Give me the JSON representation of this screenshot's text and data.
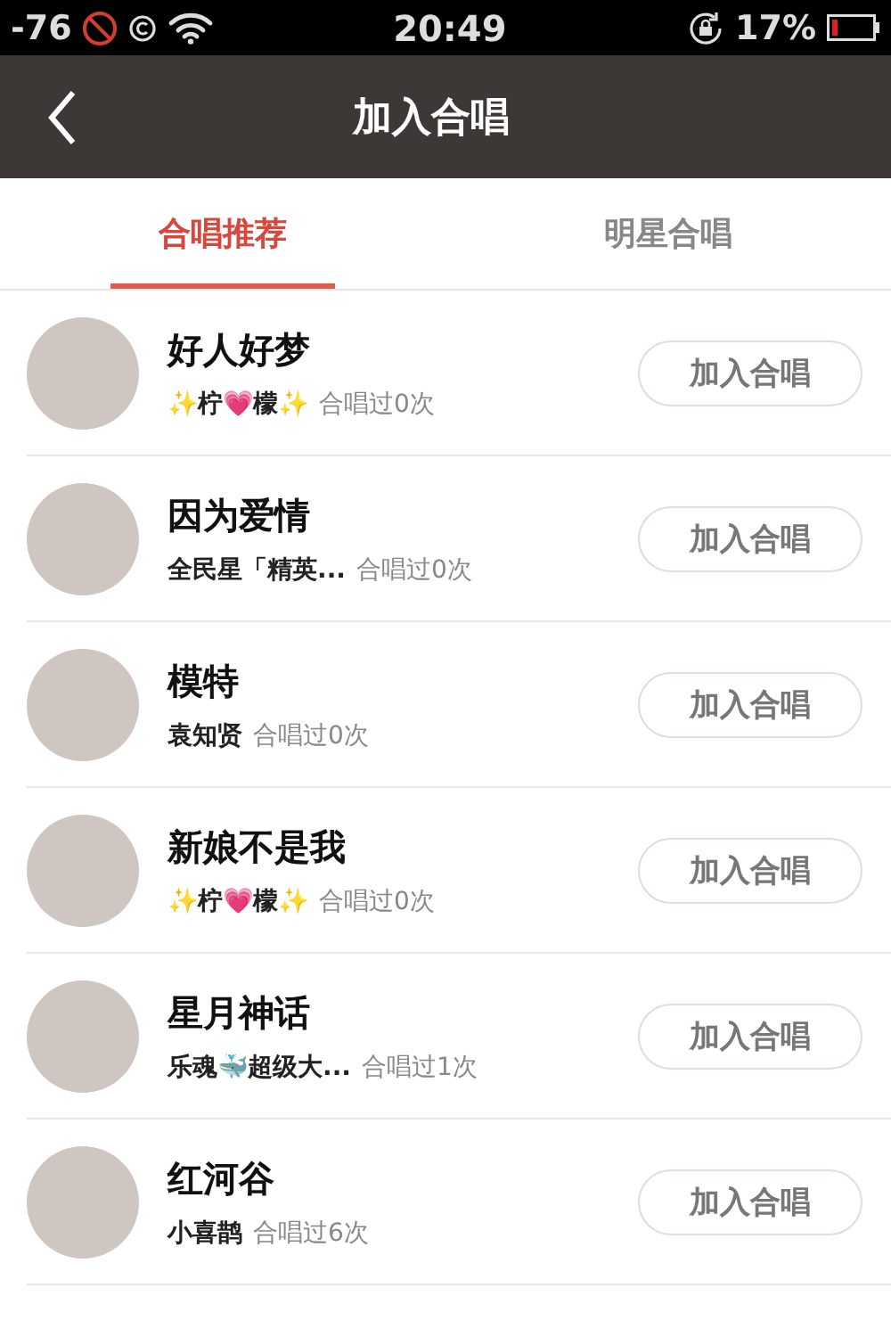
{
  "status_bar": {
    "signal": "-76",
    "time": "20:49",
    "battery": "17%"
  },
  "nav": {
    "title": "加入合唱"
  },
  "tabs": [
    {
      "label": "合唱推荐",
      "selected": true
    },
    {
      "label": "明星合唱",
      "selected": false
    }
  ],
  "rows": [
    {
      "song": "好人好梦",
      "singer": "✨柠💗檬✨",
      "count": "合唱过0次",
      "button": "加入合唱"
    },
    {
      "song": "因为爱情",
      "singer": "全民星「精英...",
      "count": "合唱过0次",
      "button": "加入合唱"
    },
    {
      "song": "模特",
      "singer": "袁知贤",
      "count": "合唱过0次",
      "button": "加入合唱"
    },
    {
      "song": "新娘不是我",
      "singer": "✨柠💗檬✨",
      "count": "合唱过0次",
      "button": "加入合唱"
    },
    {
      "song": "星月神话",
      "singer": "乐魂🐳超级大...",
      "count": "合唱过1次",
      "button": "加入合唱"
    },
    {
      "song": "红河谷",
      "singer": "小喜鹊",
      "count": "合唱过6次",
      "button": "加入合唱"
    }
  ]
}
